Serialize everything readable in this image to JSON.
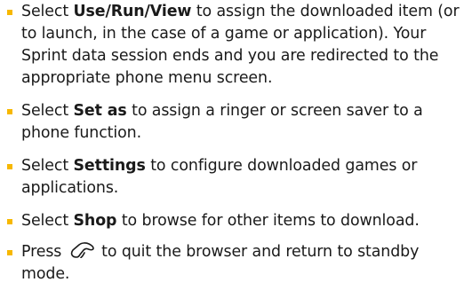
{
  "colors": {
    "bullet": "#f7b800",
    "text": "#1a1a1a"
  },
  "items": [
    {
      "prefix": "Select ",
      "bold": "Use/Run/View",
      "suffix": " to assign the downloaded item (or to launch, in the case of a game or application). Your Sprint data session ends and you are redirected to the appropriate phone menu screen."
    },
    {
      "prefix": "Select ",
      "bold": "Set as",
      "suffix": " to assign a ringer or screen saver to a phone function."
    },
    {
      "prefix": "Select ",
      "bold": "Settings",
      "suffix": " to configure downloaded games or applications."
    },
    {
      "prefix": "Select ",
      "bold": "Shop",
      "suffix": " to browse for other items to download."
    },
    {
      "prefix": "Press ",
      "icon": "end-key-icon",
      "suffix": " to quit the browser and return to standby mode."
    }
  ]
}
